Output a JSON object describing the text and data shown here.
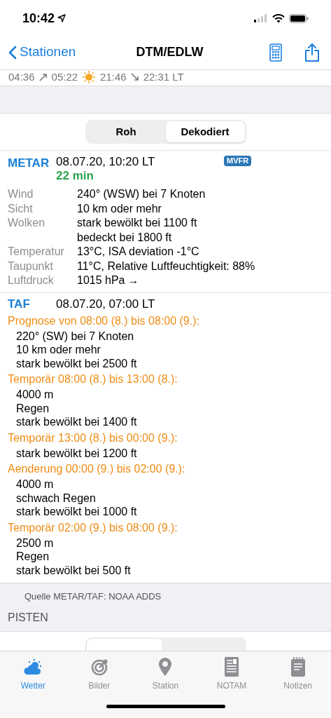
{
  "status_bar": {
    "time": "10:42"
  },
  "nav": {
    "back": "Stationen",
    "title": "DTM/EDLW"
  },
  "sun_times": [
    "04:36",
    "05:22",
    "21:46",
    "22:31 LT"
  ],
  "mode_tabs": [
    {
      "label": "Roh",
      "selected": false
    },
    {
      "label": "Dekodiert",
      "selected": true
    }
  ],
  "metar": {
    "label": "METAR",
    "time": "08.07.20, 10:20 LT",
    "age": "22 min",
    "category": "MVFR",
    "rows": [
      {
        "label": "Wind",
        "values": [
          "240° (WSW) bei 7 Knoten"
        ]
      },
      {
        "label": "Sicht",
        "values": [
          "10 km oder mehr"
        ]
      },
      {
        "label": "Wolken",
        "values": [
          "stark bewölkt bei 1100 ft",
          "bedeckt bei 1800 ft"
        ]
      },
      {
        "label": "Temperatur",
        "values": [
          "13°C, ISA deviation -1°C"
        ]
      },
      {
        "label": "Taupunkt",
        "values": [
          "11°C, Relative Luftfeuchtigkeit: 88%"
        ]
      },
      {
        "label": "Luftdruck",
        "values": [
          "1015 hPa"
        ],
        "trend": "→"
      }
    ]
  },
  "taf": {
    "label": "TAF",
    "time": "08.07.20, 07:00 LT",
    "periods": [
      {
        "header": "Prognose von 08:00 (8.) bis 08:00 (9.):",
        "lines": [
          "220° (SW) bei 7 Knoten",
          "10 km oder mehr",
          "stark bewölkt bei 2500 ft"
        ]
      },
      {
        "header": "Temporär 08:00 (8.) bis 13:00 (8.):",
        "lines": [
          "4000 m",
          "Regen",
          "stark bewölkt bei 1400 ft"
        ]
      },
      {
        "header": "Temporär 13:00 (8.) bis 00:00 (9.):",
        "lines": [
          "stark bewölkt bei 1200 ft"
        ]
      },
      {
        "header": "Aenderung 00:00 (9.) bis 02:00 (9.):",
        "lines": [
          "4000 m",
          "schwach Regen",
          "stark bewölkt bei 1000 ft"
        ]
      },
      {
        "header": "Temporär 02:00 (9.) bis 08:00 (9.):",
        "lines": [
          "2500 m",
          "Regen",
          "stark bewölkt bei 500 ft"
        ]
      }
    ]
  },
  "source": "Quelle METAR/TAF: NOAA ADDS",
  "pisten": {
    "title": "PISTEN"
  },
  "tab_bar": [
    {
      "label": "Wetter",
      "kind": "weather",
      "selected": true
    },
    {
      "label": "Bilder",
      "kind": "images",
      "selected": false
    },
    {
      "label": "Station",
      "kind": "station",
      "selected": false
    },
    {
      "label": "NOTAM",
      "kind": "notam",
      "selected": false
    },
    {
      "label": "Notizen",
      "kind": "notes",
      "selected": false
    }
  ]
}
